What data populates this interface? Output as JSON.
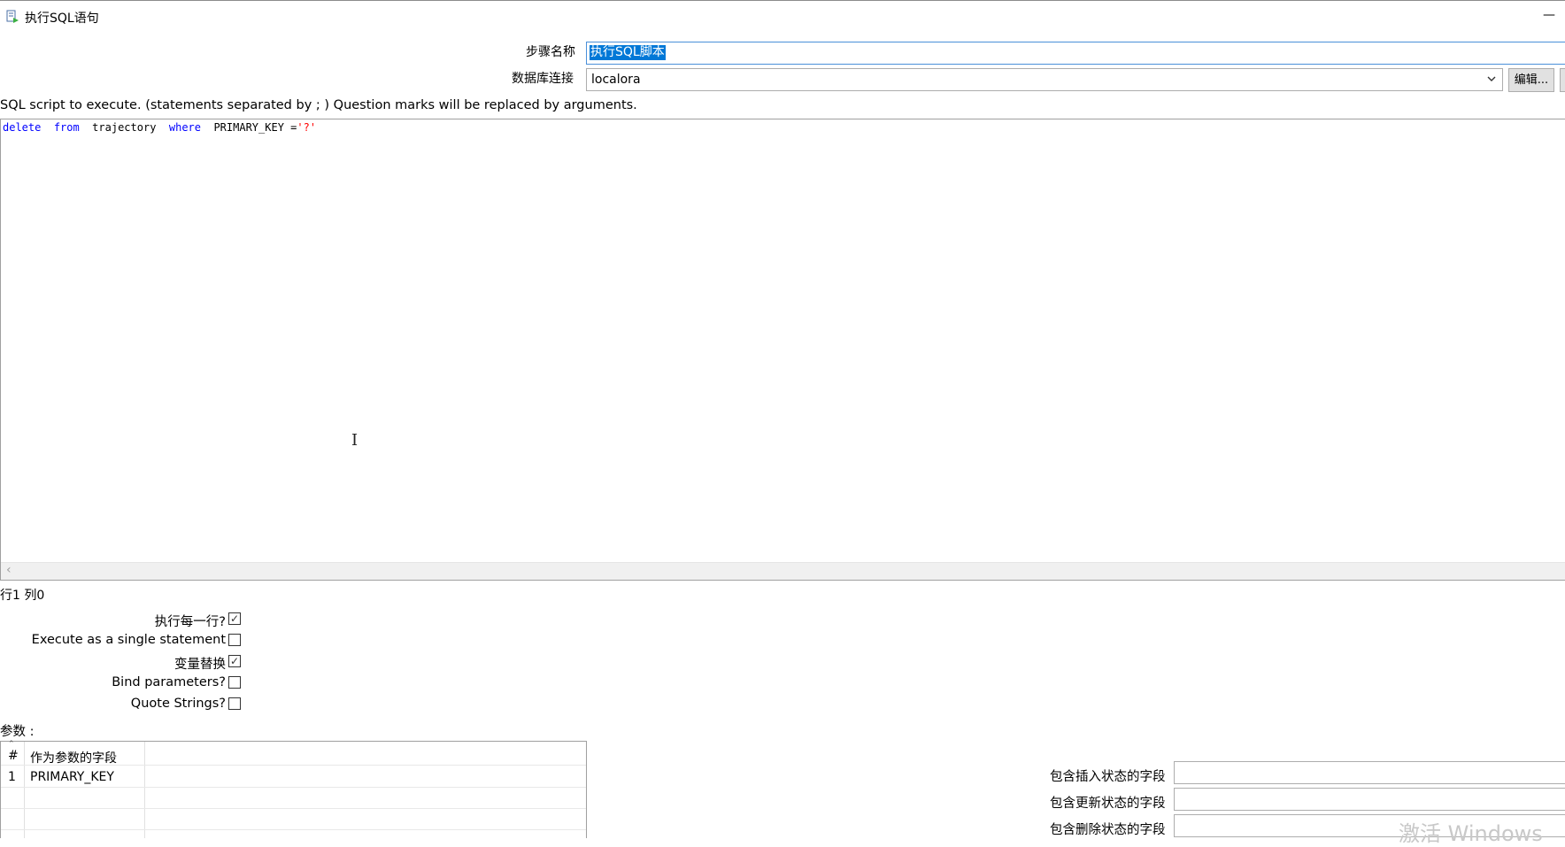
{
  "window": {
    "title": "执行SQL语句",
    "minimize_glyph": "—"
  },
  "form": {
    "step_name_label": "步骤名称",
    "step_name_value": "执行SQL脚本",
    "db_connection_label": "数据库连接",
    "db_connection_value": "localora",
    "edit_button": "编辑..."
  },
  "sql_help": "SQL script to execute. (statements separated by ; ) Question marks will be replaced by arguments.",
  "editor": {
    "tokens": [
      {
        "text": "delete",
        "kind": "keyword"
      },
      {
        "text": "  ",
        "kind": "space"
      },
      {
        "text": "from",
        "kind": "keyword"
      },
      {
        "text": "  ",
        "kind": "space"
      },
      {
        "text": "trajectory",
        "kind": "identifier"
      },
      {
        "text": "  ",
        "kind": "space"
      },
      {
        "text": "where",
        "kind": "keyword"
      },
      {
        "text": "  ",
        "kind": "space"
      },
      {
        "text": "PRIMARY_KEY =",
        "kind": "identifier"
      },
      {
        "text": "'?'",
        "kind": "string"
      }
    ],
    "cursor_position": "行1 列0"
  },
  "options": [
    {
      "label": "执行每一行?",
      "checked": true
    },
    {
      "label": "Execute as a single statement",
      "checked": false
    },
    {
      "label": "变量替换",
      "checked": true
    },
    {
      "label": "Bind parameters?",
      "checked": false
    },
    {
      "label": "Quote Strings?",
      "checked": false
    }
  ],
  "parameters": {
    "label": "参数 :",
    "columns": [
      "#",
      "作为参数的字段"
    ],
    "rows": [
      {
        "num": "1",
        "field": "PRIMARY_KEY"
      }
    ]
  },
  "status_fields": {
    "insert_label": "包含插入状态的字段",
    "update_label": "包含更新状态的字段",
    "delete_label": "包含删除状态的字段"
  },
  "watermark": "激活 Windows"
}
